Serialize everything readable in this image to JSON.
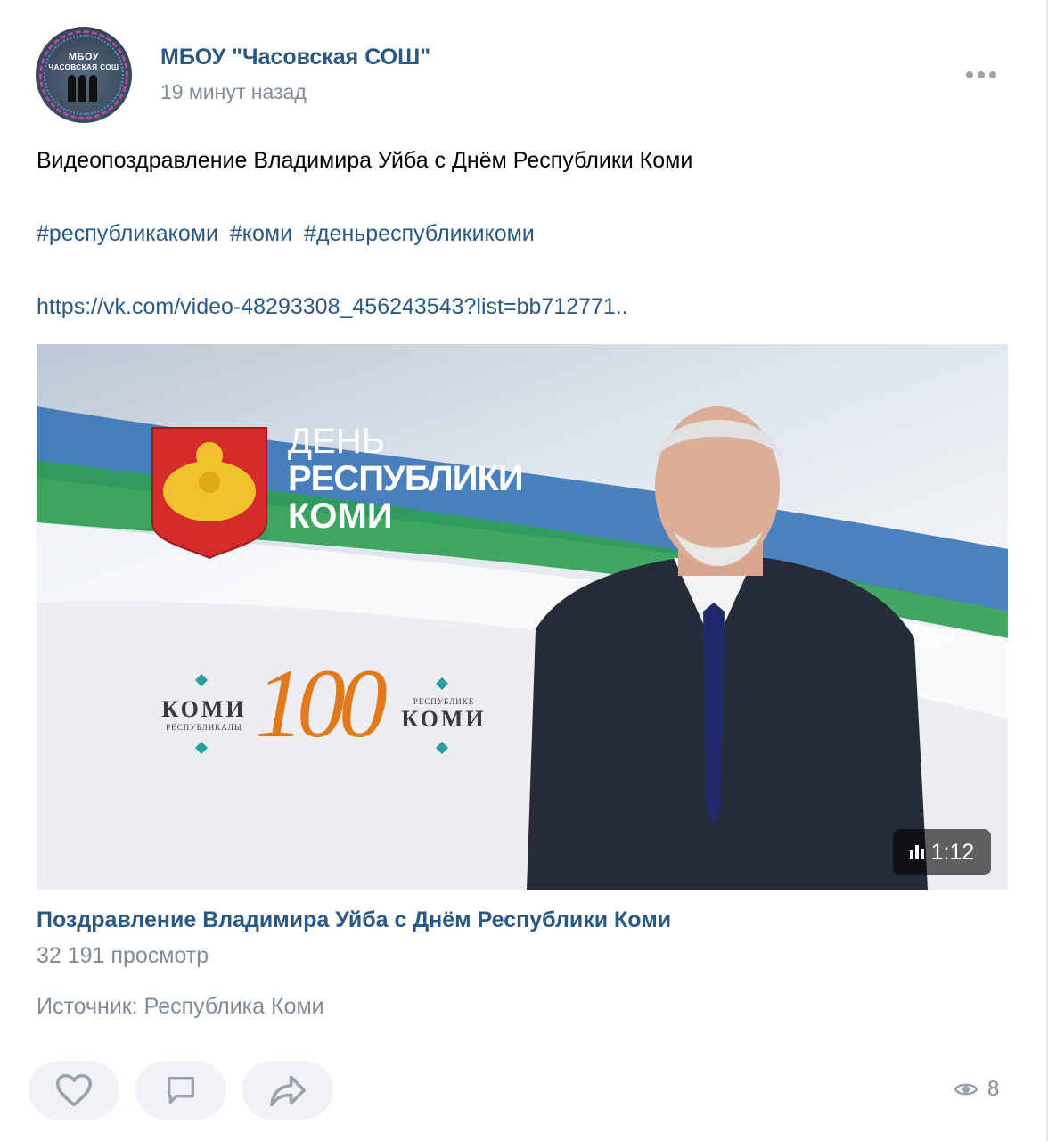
{
  "post": {
    "group_name": "МБОУ \"Часовская СОШ\"",
    "time": "19 минут назад",
    "avatar_text_line1": "МБОУ",
    "avatar_text_line2": "ЧАСОВСКАЯ СОШ",
    "text": "Видеопоздравление Владимира Уйба с Днём Республики Коми",
    "hashtags": [
      "#республикакоми",
      "#коми",
      "#деньреспубликикоми"
    ],
    "link": "https://vk.com/video-48293308_456243543?list=bb712771.."
  },
  "video": {
    "overlay_title_line1": "ДЕНЬ",
    "overlay_title_line2": "РЕСПУБЛИКИ",
    "overlay_title_line3": "КОМИ",
    "emblem_left_line1": "КОМИ",
    "emblem_left_line2": "РЕСПУБЛИКАЛЫ",
    "emblem_number": "100",
    "emblem_right_line1": "РЕСПУБЛИКЕ",
    "emblem_right_line2": "КОМИ",
    "duration": "1:12",
    "title": "Поздравление Владимира Уйба с Днём Республики Коми",
    "views": "32 191 просмотр"
  },
  "source": "Источник: Республика Коми",
  "footer": {
    "view_count": "8"
  },
  "colors": {
    "link": "#2a5885",
    "secondary_text": "#818c99",
    "button_bg": "#f0f2f5",
    "icon": "#99a2ad"
  },
  "icons": {
    "like": "heart-icon",
    "comment": "comment-icon",
    "share": "share-icon",
    "views": "eye-icon",
    "more": "more-horizontal-icon",
    "duration": "bars-icon"
  }
}
